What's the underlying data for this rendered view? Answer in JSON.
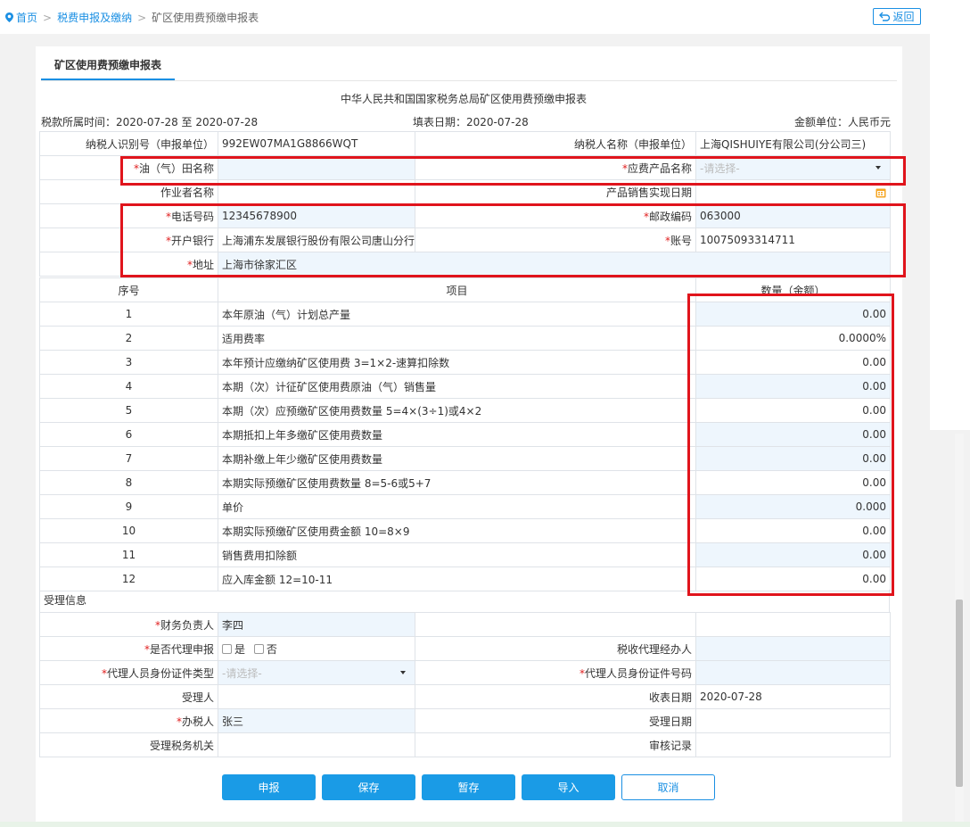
{
  "breadcrumb": {
    "home": "首页",
    "level2": "税费申报及缴纳",
    "level3": "矿区使用费预缴申报表",
    "sep": ">"
  },
  "back_label": "返回",
  "tab_label": "矿区使用费预缴申报表",
  "form": {
    "title": "中华人民共和国国家税务总局矿区使用费预缴申报表",
    "period": "税款所属时间：2020-07-28 至 2020-07-28",
    "fill_date": "填表日期：2020-07-28",
    "unit": "金额单位：人民币元"
  },
  "header_rows": {
    "taxpayer_id_label": "纳税人识别号（申报单位）",
    "taxpayer_id": "992EW07MA1G8866WQT",
    "taxpayer_name_label": "纳税人名称（申报单位）",
    "taxpayer_name": "上海QISHUIYE有限公司(分公司三)",
    "field_name_label": "油（气）田名称",
    "field_name": "",
    "product_label": "应费产品名称",
    "product_placeholder": "-请选择-",
    "operator_label": "作业者名称",
    "operator": "",
    "sales_date_label": "产品销售实现日期",
    "sales_date": "",
    "phone_label": "电话号码",
    "phone": "12345678900",
    "postcode_label": "邮政编码",
    "postcode": "063000",
    "bank_label": "开户银行",
    "bank": "上海浦东发展银行股份有限公司唐山分行",
    "account_label": "账号",
    "account": "10075093314711",
    "address_label": "地址",
    "address": "上海市徐家汇区",
    "required_mark": "*"
  },
  "items_header": {
    "seq": "序号",
    "item": "项目",
    "amount": "数量（金额）"
  },
  "items": [
    {
      "seq": "1",
      "name": "本年原油（气）计划总产量",
      "value": "0.00",
      "editable": true
    },
    {
      "seq": "2",
      "name": "适用费率",
      "value": "0.0000%",
      "editable": false
    },
    {
      "seq": "3",
      "name": "本年预计应缴纳矿区使用费 3=1×2-速算扣除数",
      "value": "0.00",
      "editable": false
    },
    {
      "seq": "4",
      "name": "本期（次）计征矿区使用费原油（气）销售量",
      "value": "0.00",
      "editable": true
    },
    {
      "seq": "5",
      "name": "本期（次）应预缴矿区使用费数量 5=4×(3÷1)或4×2",
      "value": "0.00",
      "editable": false
    },
    {
      "seq": "6",
      "name": "本期抵扣上年多缴矿区使用费数量",
      "value": "0.00",
      "editable": true
    },
    {
      "seq": "7",
      "name": "本期补缴上年少缴矿区使用费数量",
      "value": "0.00",
      "editable": true
    },
    {
      "seq": "8",
      "name": "本期实际预缴矿区使用费数量 8=5-6或5+7",
      "value": "0.00",
      "editable": false
    },
    {
      "seq": "9",
      "name": "单价",
      "value": "0.000",
      "editable": true
    },
    {
      "seq": "10",
      "name": "本期实际预缴矿区使用费金额 10=8×9",
      "value": "0.00",
      "editable": false
    },
    {
      "seq": "11",
      "name": "销售费用扣除额",
      "value": "0.00",
      "editable": true
    },
    {
      "seq": "12",
      "name": "应入库金额 12=10-11",
      "value": "0.00",
      "editable": false
    }
  ],
  "acceptance": {
    "section_label": "受理信息",
    "finance_head_label": "财务负责人",
    "finance_head": "李四",
    "is_agent_label": "是否代理申报",
    "yes": "是",
    "no": "否",
    "agent_handler_label": "税收代理经办人",
    "agent_handler": "",
    "agent_id_type_label": "代理人员身份证件类型",
    "agent_id_type_placeholder": "-请选择-",
    "agent_id_no_label": "代理人员身份证件号码",
    "agent_id_no": "",
    "receiver_label": "受理人",
    "receiver": "",
    "receive_date_label": "收表日期",
    "receive_date": "2020-07-28",
    "handler_label": "办税人",
    "handler": "张三",
    "accept_date_label": "受理日期",
    "accept_date": "",
    "tax_office_label": "受理税务机关",
    "tax_office": "",
    "audit_label": "审核记录",
    "audit": ""
  },
  "buttons": {
    "submit": "申报",
    "save": "保存",
    "draft": "暂存",
    "import": "导入",
    "cancel": "取消"
  },
  "colors": {
    "accent": "#1a8fe3",
    "button": "#1a9be6",
    "highlight_box": "#e0141c",
    "edit_cell": "#eef6fd",
    "required": "#e02020"
  },
  "icons": [
    "location-pin-icon",
    "return-arrow-icon",
    "calendar-icon",
    "chevron-down-icon"
  ]
}
